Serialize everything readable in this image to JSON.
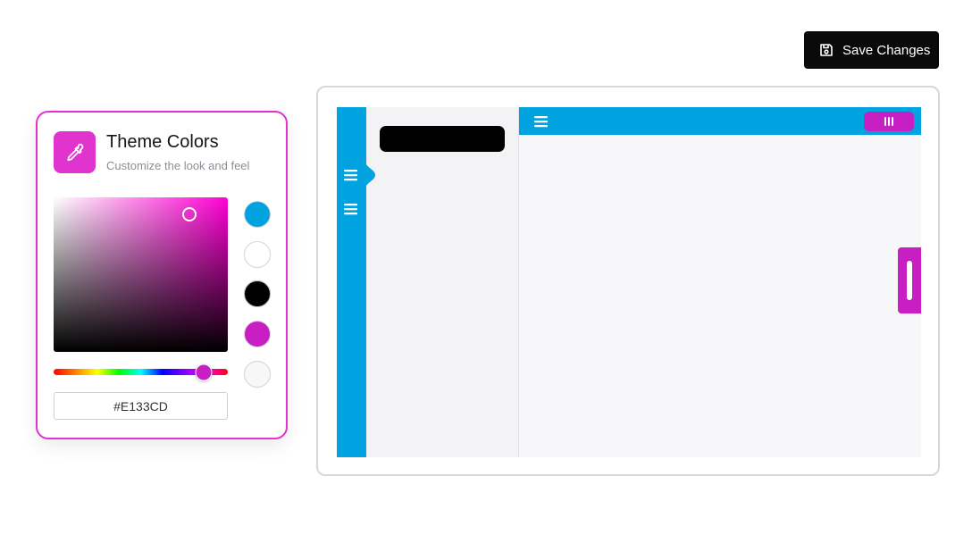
{
  "toolbar": {
    "save_label": "Save Changes",
    "save_icon": "floppy-disk-icon"
  },
  "theme_card": {
    "icon": "eyedropper-icon",
    "title": "Theme Colors",
    "subtitle": "Customize the look and feel",
    "hex_value": "#E133CD",
    "hue_fraction": 0.86,
    "saturation_fraction": 0.78,
    "brightness_fraction": 0.89,
    "swatches": [
      {
        "name": "blue",
        "color": "#00a3e0"
      },
      {
        "name": "white",
        "color": "#ffffff"
      },
      {
        "name": "black",
        "color": "#000000"
      },
      {
        "name": "magenta",
        "color": "#c81fc2"
      },
      {
        "name": "light-gray",
        "color": "#f7f7f8"
      }
    ]
  },
  "preview": {
    "primary_color": "#00a3e0",
    "accent_color": "#c81fc2",
    "pill_color": "#000000",
    "rail_icons": [
      "menu-icon",
      "menu-icon"
    ],
    "topbar_icon": "menu-icon",
    "topbar_pill_icon": "grip-lines-icon"
  },
  "colors": {
    "card_border": "#e133cd",
    "save_button": "#0a0a0a"
  }
}
